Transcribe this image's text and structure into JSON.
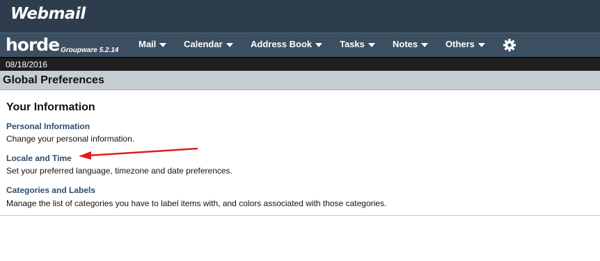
{
  "app": {
    "logo_text": "Webmail",
    "brand": "horde",
    "version": "Groupware 5.2.14"
  },
  "menu": [
    {
      "label": "Mail"
    },
    {
      "label": "Calendar"
    },
    {
      "label": "Address Book"
    },
    {
      "label": "Tasks"
    },
    {
      "label": "Notes"
    },
    {
      "label": "Others"
    }
  ],
  "settings_icon": "gear-icon",
  "date": "08/18/2016",
  "page_title": "Global Preferences",
  "group": {
    "heading": "Your Information",
    "items": [
      {
        "label": "Personal Information",
        "description": "Change your personal information."
      },
      {
        "label": "Locale and Time",
        "description": "Set your preferred language, timezone and date preferences."
      },
      {
        "label": "Categories and Labels",
        "description": "Manage the list of categories you have to label items with, and colors associated with those categories."
      }
    ]
  },
  "annotation": {
    "type": "arrow",
    "color": "#e01b1b",
    "points_to": "Locale and Time"
  }
}
